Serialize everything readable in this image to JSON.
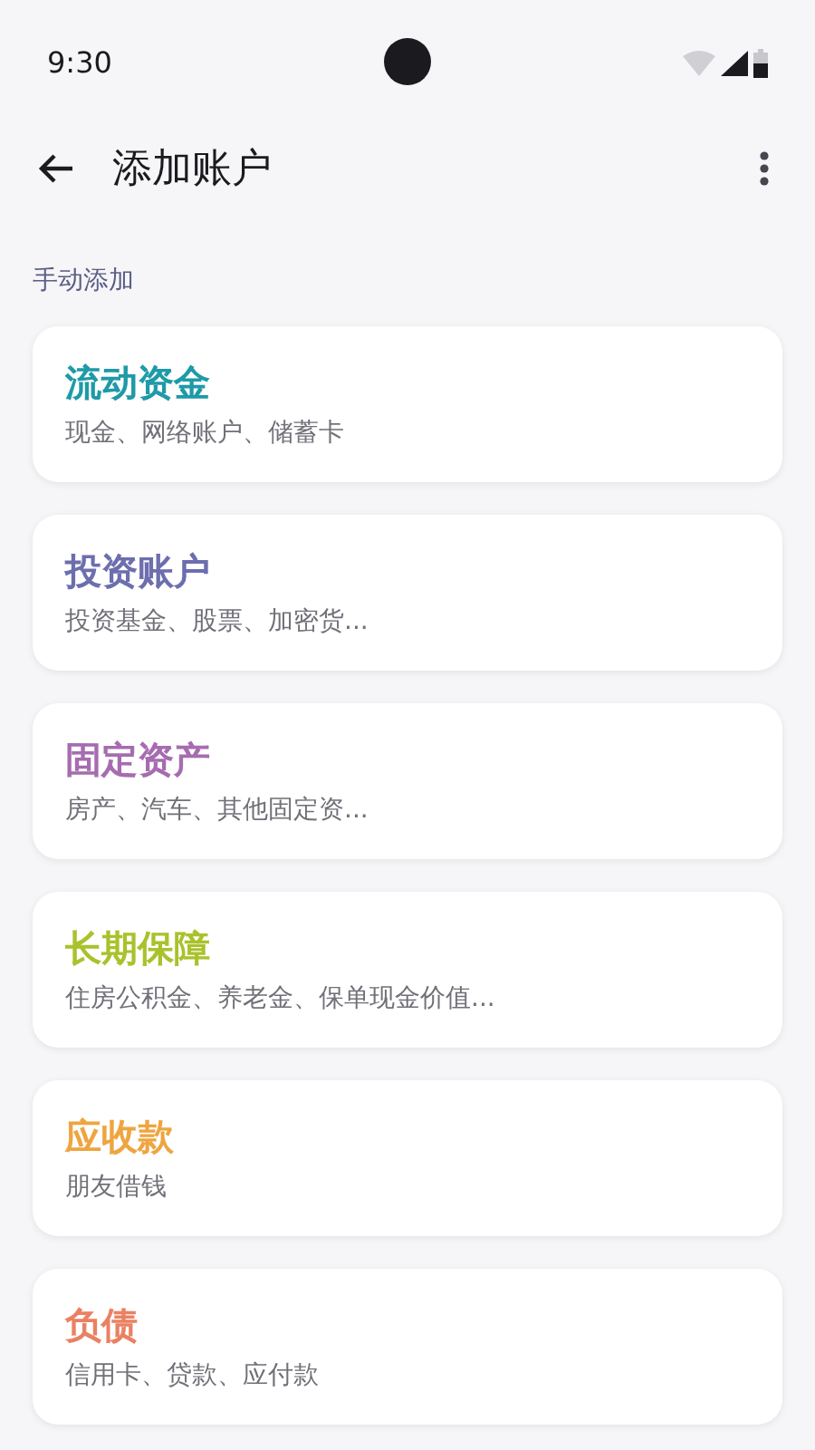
{
  "status_bar": {
    "time": "9:30"
  },
  "app_bar": {
    "title": "添加账户"
  },
  "section": {
    "label": "手动添加"
  },
  "accounts": [
    {
      "title": "流动资金",
      "subtitle": "现金、网络账户、储蓄卡",
      "color": "#1e9aa8"
    },
    {
      "title": "投资账户",
      "subtitle": "投资基金、股票、加密货...",
      "color": "#6d6eae"
    },
    {
      "title": "固定资产",
      "subtitle": "房产、汽车、其他固定资...",
      "color": "#a66cb0"
    },
    {
      "title": "长期保障",
      "subtitle": "住房公积金、养老金、保单现金价值...",
      "color": "#a9c22c"
    },
    {
      "title": "应收款",
      "subtitle": "朋友借钱",
      "color": "#eea540"
    },
    {
      "title": "负债",
      "subtitle": "信用卡、贷款、应付款",
      "color": "#ea8163"
    }
  ]
}
